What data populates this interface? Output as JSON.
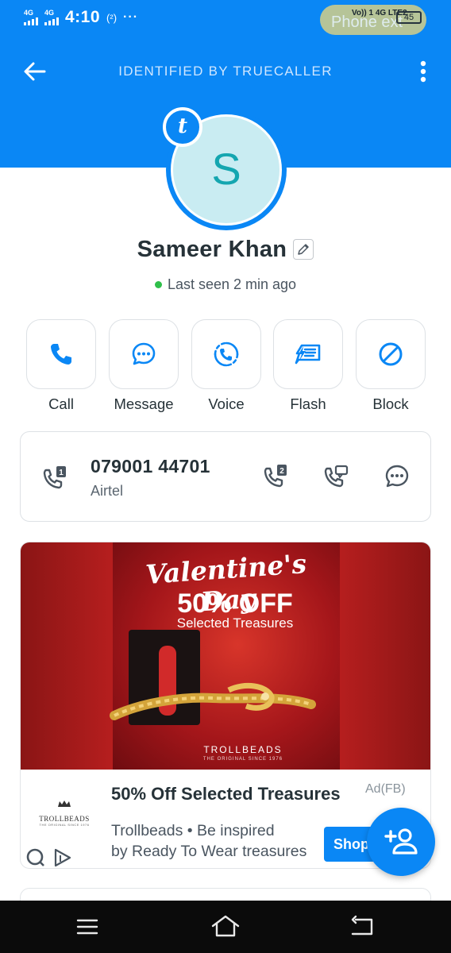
{
  "status_bar": {
    "signal_1": "4G",
    "signal_2": "4G",
    "time": "4:10",
    "extra": "(²)",
    "dots": "···",
    "network_label": "Vo)) 1 4G LTE2",
    "phone_ext_label": "Phone ext",
    "battery": "45"
  },
  "top_bar": {
    "title": "IDENTIFIED BY TRUECALLER"
  },
  "profile": {
    "badge_letter": "t",
    "avatar_letter": "S",
    "name": "Sameer Khan",
    "last_seen": "Last seen 2 min ago"
  },
  "actions": [
    {
      "label": "Call",
      "icon": "phone-icon"
    },
    {
      "label": "Message",
      "icon": "chat-bubble-icon"
    },
    {
      "label": "Voice",
      "icon": "voice-call-icon"
    },
    {
      "label": "Flash",
      "icon": "flash-message-icon"
    },
    {
      "label": "Block",
      "icon": "block-icon"
    }
  ],
  "phone_card": {
    "number": "079001 44701",
    "carrier": "Airtel",
    "sim1_badge": "1",
    "sim2_badge": "2"
  },
  "ad": {
    "image_headline": "Valentine's Day",
    "image_offer": "50% OFF",
    "image_subtitle": "Selected Treasures",
    "image_brand": "TROLLBEADS",
    "image_brand_sub": "THE ORIGINAL SINCE 1976",
    "logo_name": "TROLLBEADS",
    "logo_sub": "THE ORIGINAL SINCE 1976",
    "title": "50% Off Selected Treasures",
    "tag": "Ad(FB)",
    "desc_line1": "Trollbeads • Be inspired",
    "desc_line2": "by Ready To Wear treasures",
    "cta": "Shop"
  },
  "colors": {
    "brand_blue": "#0a87f5",
    "online_green": "#2fbf4a",
    "avatar_bg": "#c9ecf2"
  }
}
